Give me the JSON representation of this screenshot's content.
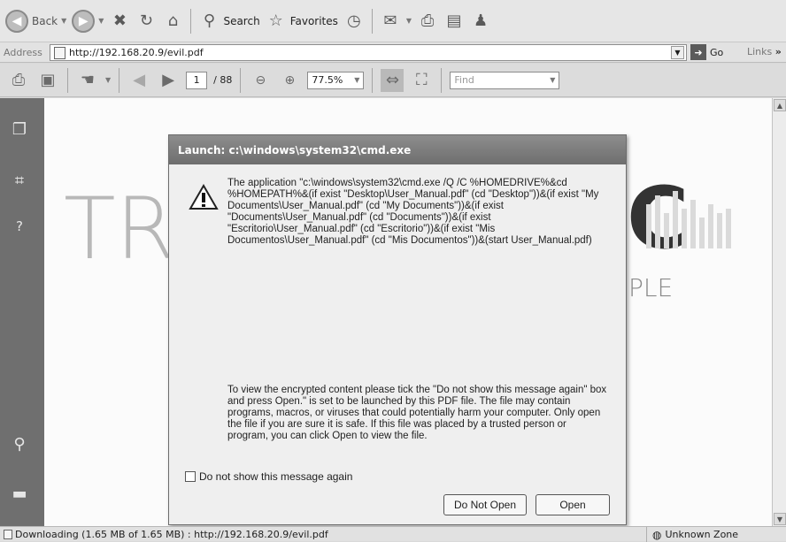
{
  "ie_toolbar": {
    "back_label": "Back",
    "search_label": "Search",
    "favorites_label": "Favorites"
  },
  "address_bar": {
    "label": "Address",
    "url": "http://192.168.20.9/evil.pdf",
    "go_label": "Go",
    "links_label": "Links",
    "links_chevron": "»"
  },
  "reader_toolbar": {
    "page_number": "1",
    "page_total": "/ 88",
    "zoom": "77.5%",
    "find_placeholder": "Find"
  },
  "document": {
    "bg_left_text": "TR",
    "bg_right_letter": "C",
    "bg_right_text": "PLE"
  },
  "dialog": {
    "title": "Launch: c:\\windows\\system32\\cmd.exe",
    "message": "The application \"c:\\windows\\system32\\cmd.exe /Q /C %HOMEDRIVE%&cd %HOMEPATH%&(if exist \"Desktop\\User_Manual.pdf\" (cd \"Desktop\"))&(if exist \"My Documents\\User_Manual.pdf\" (cd \"My Documents\"))&(if exist \"Documents\\User_Manual.pdf\" (cd \"Documents\"))&(if exist \"Escritorio\\User_Manual.pdf\" (cd \"Escritorio\"))&(if exist \"Mis Documentos\\User_Manual.pdf\" (cd \"Mis Documentos\"))&(start User_Manual.pdf)",
    "info": "To view the encrypted content please tick the \"Do not show this message again\" box and press Open.\" is set to be launched by this PDF file. The file may contain programs, macros, or viruses that could potentially harm your computer. Only open the file if you are sure it is safe. If this file was placed by a trusted person or program, you can click Open to view the file.",
    "checkbox_label": "Do not show this message again",
    "do_not_open_label": "Do Not Open",
    "open_label": "Open"
  },
  "status_bar": {
    "text": "Downloading (1.65 MB of 1.65 MB) : http://192.168.20.9/evil.pdf",
    "zone": "Unknown Zone"
  }
}
